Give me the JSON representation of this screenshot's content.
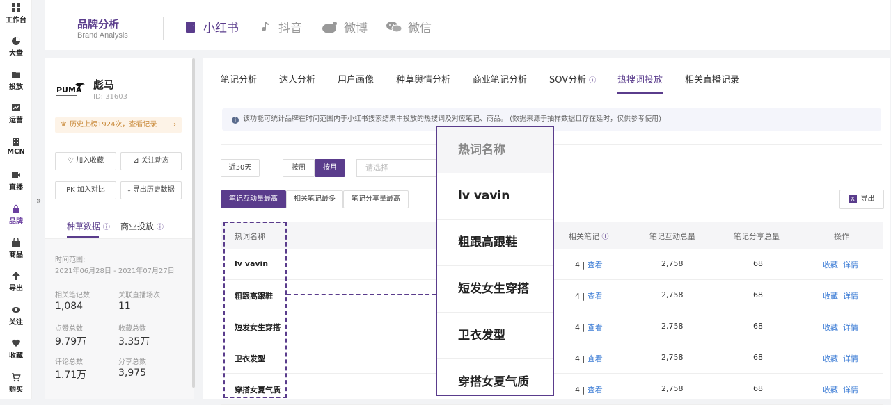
{
  "nav": [
    {
      "label": "工作台",
      "icon": "grid-icon"
    },
    {
      "label": "大盘",
      "icon": "pie-icon"
    },
    {
      "label": "投放",
      "icon": "folder-icon"
    },
    {
      "label": "运营",
      "icon": "chart-icon"
    },
    {
      "label": "MCN",
      "icon": "building-icon"
    },
    {
      "label": "直播",
      "icon": "video-icon"
    },
    {
      "label": "品牌",
      "icon": "bag-icon"
    },
    {
      "label": "商品",
      "icon": "shop-icon"
    },
    {
      "label": "导出",
      "icon": "upload-icon"
    },
    {
      "label": "关注",
      "icon": "eye-icon"
    },
    {
      "label": "收藏",
      "icon": "heart-icon"
    },
    {
      "label": "购买",
      "icon": "cart-icon"
    }
  ],
  "header": {
    "title": "品牌分析",
    "subtitle": "Brand Analysis",
    "platforms": [
      "小红书",
      "抖音",
      "微博",
      "微信"
    ]
  },
  "brand": {
    "name": "彪马",
    "id": "ID: 31603",
    "history": "历史上榜1924次，查看记录",
    "actions": [
      "加入收藏",
      "关注动态",
      "加入对比",
      "导出历史数据"
    ],
    "tabs": [
      "种草数据",
      "商业投放"
    ],
    "range_label": "时间范围:",
    "range_value": "2021年06月28日 - 2021年07月27日",
    "stats": [
      {
        "label": "相关笔记数",
        "value": "1,084"
      },
      {
        "label": "关联直播场次",
        "value": "11"
      },
      {
        "label": "点赞总数",
        "value": "9.79万"
      },
      {
        "label": "收藏总数",
        "value": "3.35万"
      },
      {
        "label": "评论总数",
        "value": "1.71万"
      },
      {
        "label": "分享总数",
        "value": "3,975"
      }
    ],
    "logo_text": "PUMA"
  },
  "tabs": [
    "笔记分析",
    "达人分析",
    "用户画像",
    "种草舆情分析",
    "商业笔记分析",
    "SOV分析",
    "热搜词投放",
    "相关直播记录"
  ],
  "notice": "该功能可统计品牌在时间范围内于小红书搜索结果中投放的热搜词及对应笔记、商品。 (数据来源于抽样数据且存在延时，仅供参考使用)",
  "filters": {
    "range": "近30天",
    "by_week": "按周",
    "by_month": "按月",
    "select_placeholder": "请选择",
    "sorts": [
      "笔记互动量最高",
      "相关笔记最多",
      "笔记分享量最高"
    ],
    "export": "导出"
  },
  "table": {
    "headers": [
      "热词名称",
      "相关笔记",
      "笔记互动总量",
      "笔记分享总量",
      "操作"
    ],
    "rows": [
      {
        "keyword": "lv vavin",
        "notes": "4 |",
        "view": "查看",
        "interact": "2,758",
        "share": "68",
        "fav": "收藏",
        "detail": "详情"
      },
      {
        "keyword": "粗跟高跟鞋",
        "notes": "4 |",
        "view": "查看",
        "interact": "2,758",
        "share": "68",
        "fav": "收藏",
        "detail": "详情"
      },
      {
        "keyword": "短发女生穿搭",
        "notes": "4 |",
        "view": "查看",
        "interact": "2,758",
        "share": "68",
        "fav": "收藏",
        "detail": "详情"
      },
      {
        "keyword": "卫衣发型",
        "notes": "4 |",
        "view": "查看",
        "interact": "2,758",
        "share": "68",
        "fav": "收藏",
        "detail": "详情"
      },
      {
        "keyword": "穿搭女夏气质",
        "notes": "4 |",
        "view": "查看",
        "interact": "2,758",
        "share": "68",
        "fav": "收藏",
        "detail": "详情"
      }
    ]
  },
  "zoom": {
    "header": "热词名称",
    "items": [
      "lv vavin",
      "粗跟高跟鞋",
      "短发女生穿搭",
      "卫衣发型",
      "穿搭女夏气质"
    ]
  }
}
